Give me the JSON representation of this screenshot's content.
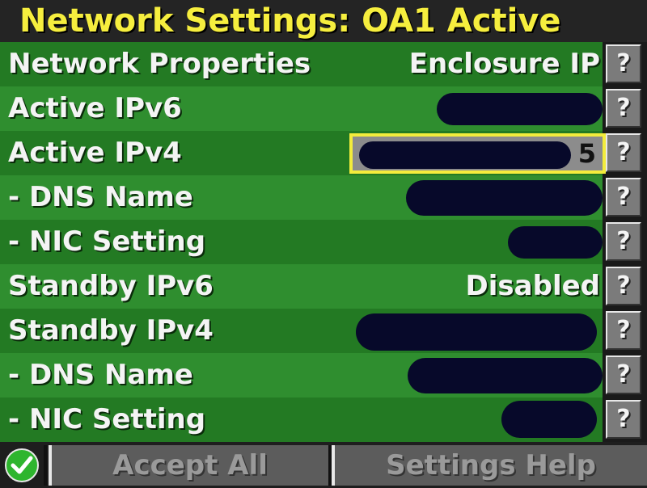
{
  "title": "Network Settings: OA1 Active",
  "rows": [
    {
      "label": "Network Properties",
      "value": "Enclosure IP",
      "help": "?"
    },
    {
      "label": "Active IPv6",
      "value": "",
      "help": "?"
    },
    {
      "label": "Active IPv4",
      "value": "5",
      "help": "?"
    },
    {
      "label": " - DNS Name",
      "value": "",
      "help": "?"
    },
    {
      "label": " - NIC Setting",
      "value": "",
      "help": "?"
    },
    {
      "label": "Standby IPv6",
      "value": "Disabled",
      "help": "?"
    },
    {
      "label": "Standby IPv4",
      "value": "",
      "help": "?"
    },
    {
      "label": " - DNS Name",
      "value": "",
      "help": "?"
    },
    {
      "label": " - NIC Setting",
      "value": "",
      "help": "?"
    }
  ],
  "bottom": {
    "accept_all": "Accept All",
    "settings_help": "Settings Help"
  },
  "colors": {
    "title_text": "#f6ee3e",
    "row_dark": "#237a23",
    "row_light": "#2f8e2f",
    "selection_border": "#f3ec3c",
    "check_green": "#2eb52e"
  }
}
